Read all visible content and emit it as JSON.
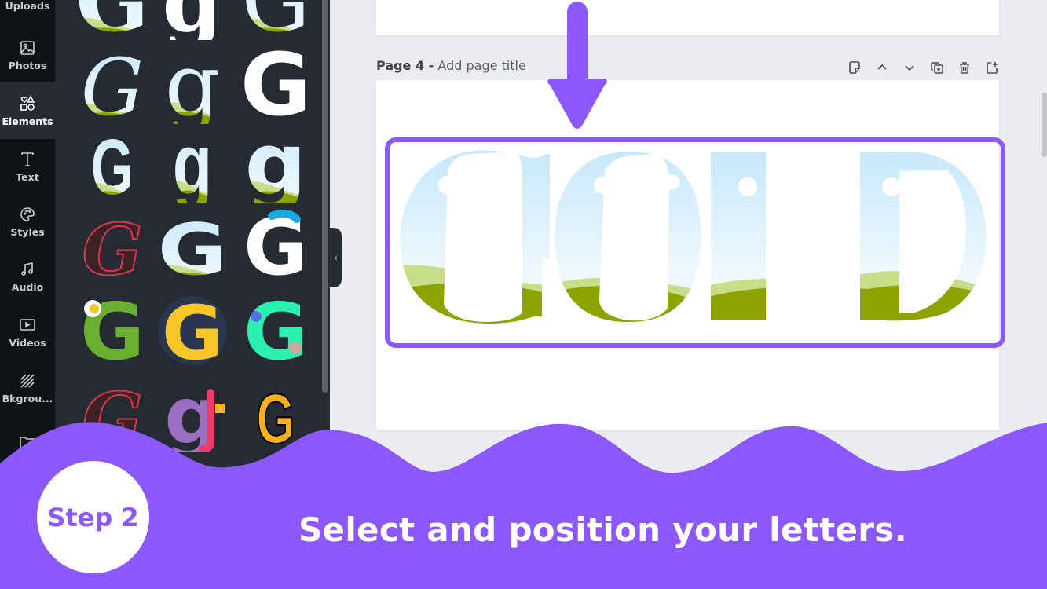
{
  "sidebar": {
    "items": [
      {
        "label": "Uploads",
        "icon": "upload-icon"
      },
      {
        "label": "Photos",
        "icon": "image-icon"
      },
      {
        "label": "Elements",
        "icon": "shapes-icon",
        "active": true
      },
      {
        "label": "Text",
        "icon": "text-icon"
      },
      {
        "label": "Styles",
        "icon": "palette-icon"
      },
      {
        "label": "Audio",
        "icon": "music-note-icon"
      },
      {
        "label": "Videos",
        "icon": "video-icon"
      },
      {
        "label": "Bkgrou...",
        "icon": "background-pattern-icon"
      },
      {
        "label": "",
        "icon": "folder-icon"
      }
    ]
  },
  "elements_panel": {
    "items": [
      {
        "name": "letter-g-landscape-serif"
      },
      {
        "name": "letter-g-white-serif-lowercase"
      },
      {
        "name": "letter-g-landscape-outline"
      },
      {
        "name": "letter-g-landscape-italic"
      },
      {
        "name": "letter-g-landscape-lowercase-serif"
      },
      {
        "name": "letter-g-white-bold"
      },
      {
        "name": "letter-g-landscape-condensed"
      },
      {
        "name": "letter-g-landscape-lowercase-condensed"
      },
      {
        "name": "letter-g-landscape-lowercase-bold"
      },
      {
        "name": "letter-g-brush-red"
      },
      {
        "name": "letter-g-landscape-wide"
      },
      {
        "name": "letter-g-white-blue-cap"
      },
      {
        "name": "letter-g-green-monster"
      },
      {
        "name": "letter-g-donut"
      },
      {
        "name": "letter-g-camo"
      },
      {
        "name": "letter-g-brush-red-2"
      },
      {
        "name": "letter-g-party-snake"
      },
      {
        "name": "letter-g-gold-3d"
      }
    ]
  },
  "canvas": {
    "page_number_label": "Page 4 -",
    "page_title_placeholder": "Add page title",
    "tools": [
      {
        "name": "notes-button",
        "icon": "sticky-note-icon"
      },
      {
        "name": "move-up-button",
        "icon": "chevron-up-icon"
      },
      {
        "name": "move-down-button",
        "icon": "chevron-down-icon"
      },
      {
        "name": "duplicate-page-button",
        "icon": "duplicate-icon"
      },
      {
        "name": "delete-page-button",
        "icon": "trash-icon"
      },
      {
        "name": "add-page-button",
        "icon": "add-page-icon"
      }
    ],
    "artwork_text": "GOLD"
  },
  "colors": {
    "accent": "#8c57fb",
    "sidebar_bg": "#0e1318",
    "panel_bg": "#252a33",
    "sky": "#c9e9fb",
    "hill_light": "#c6de88",
    "hill_dark": "#8ca300"
  },
  "banner": {
    "step_label": "Step 2",
    "caption": "Select and position your letters."
  }
}
